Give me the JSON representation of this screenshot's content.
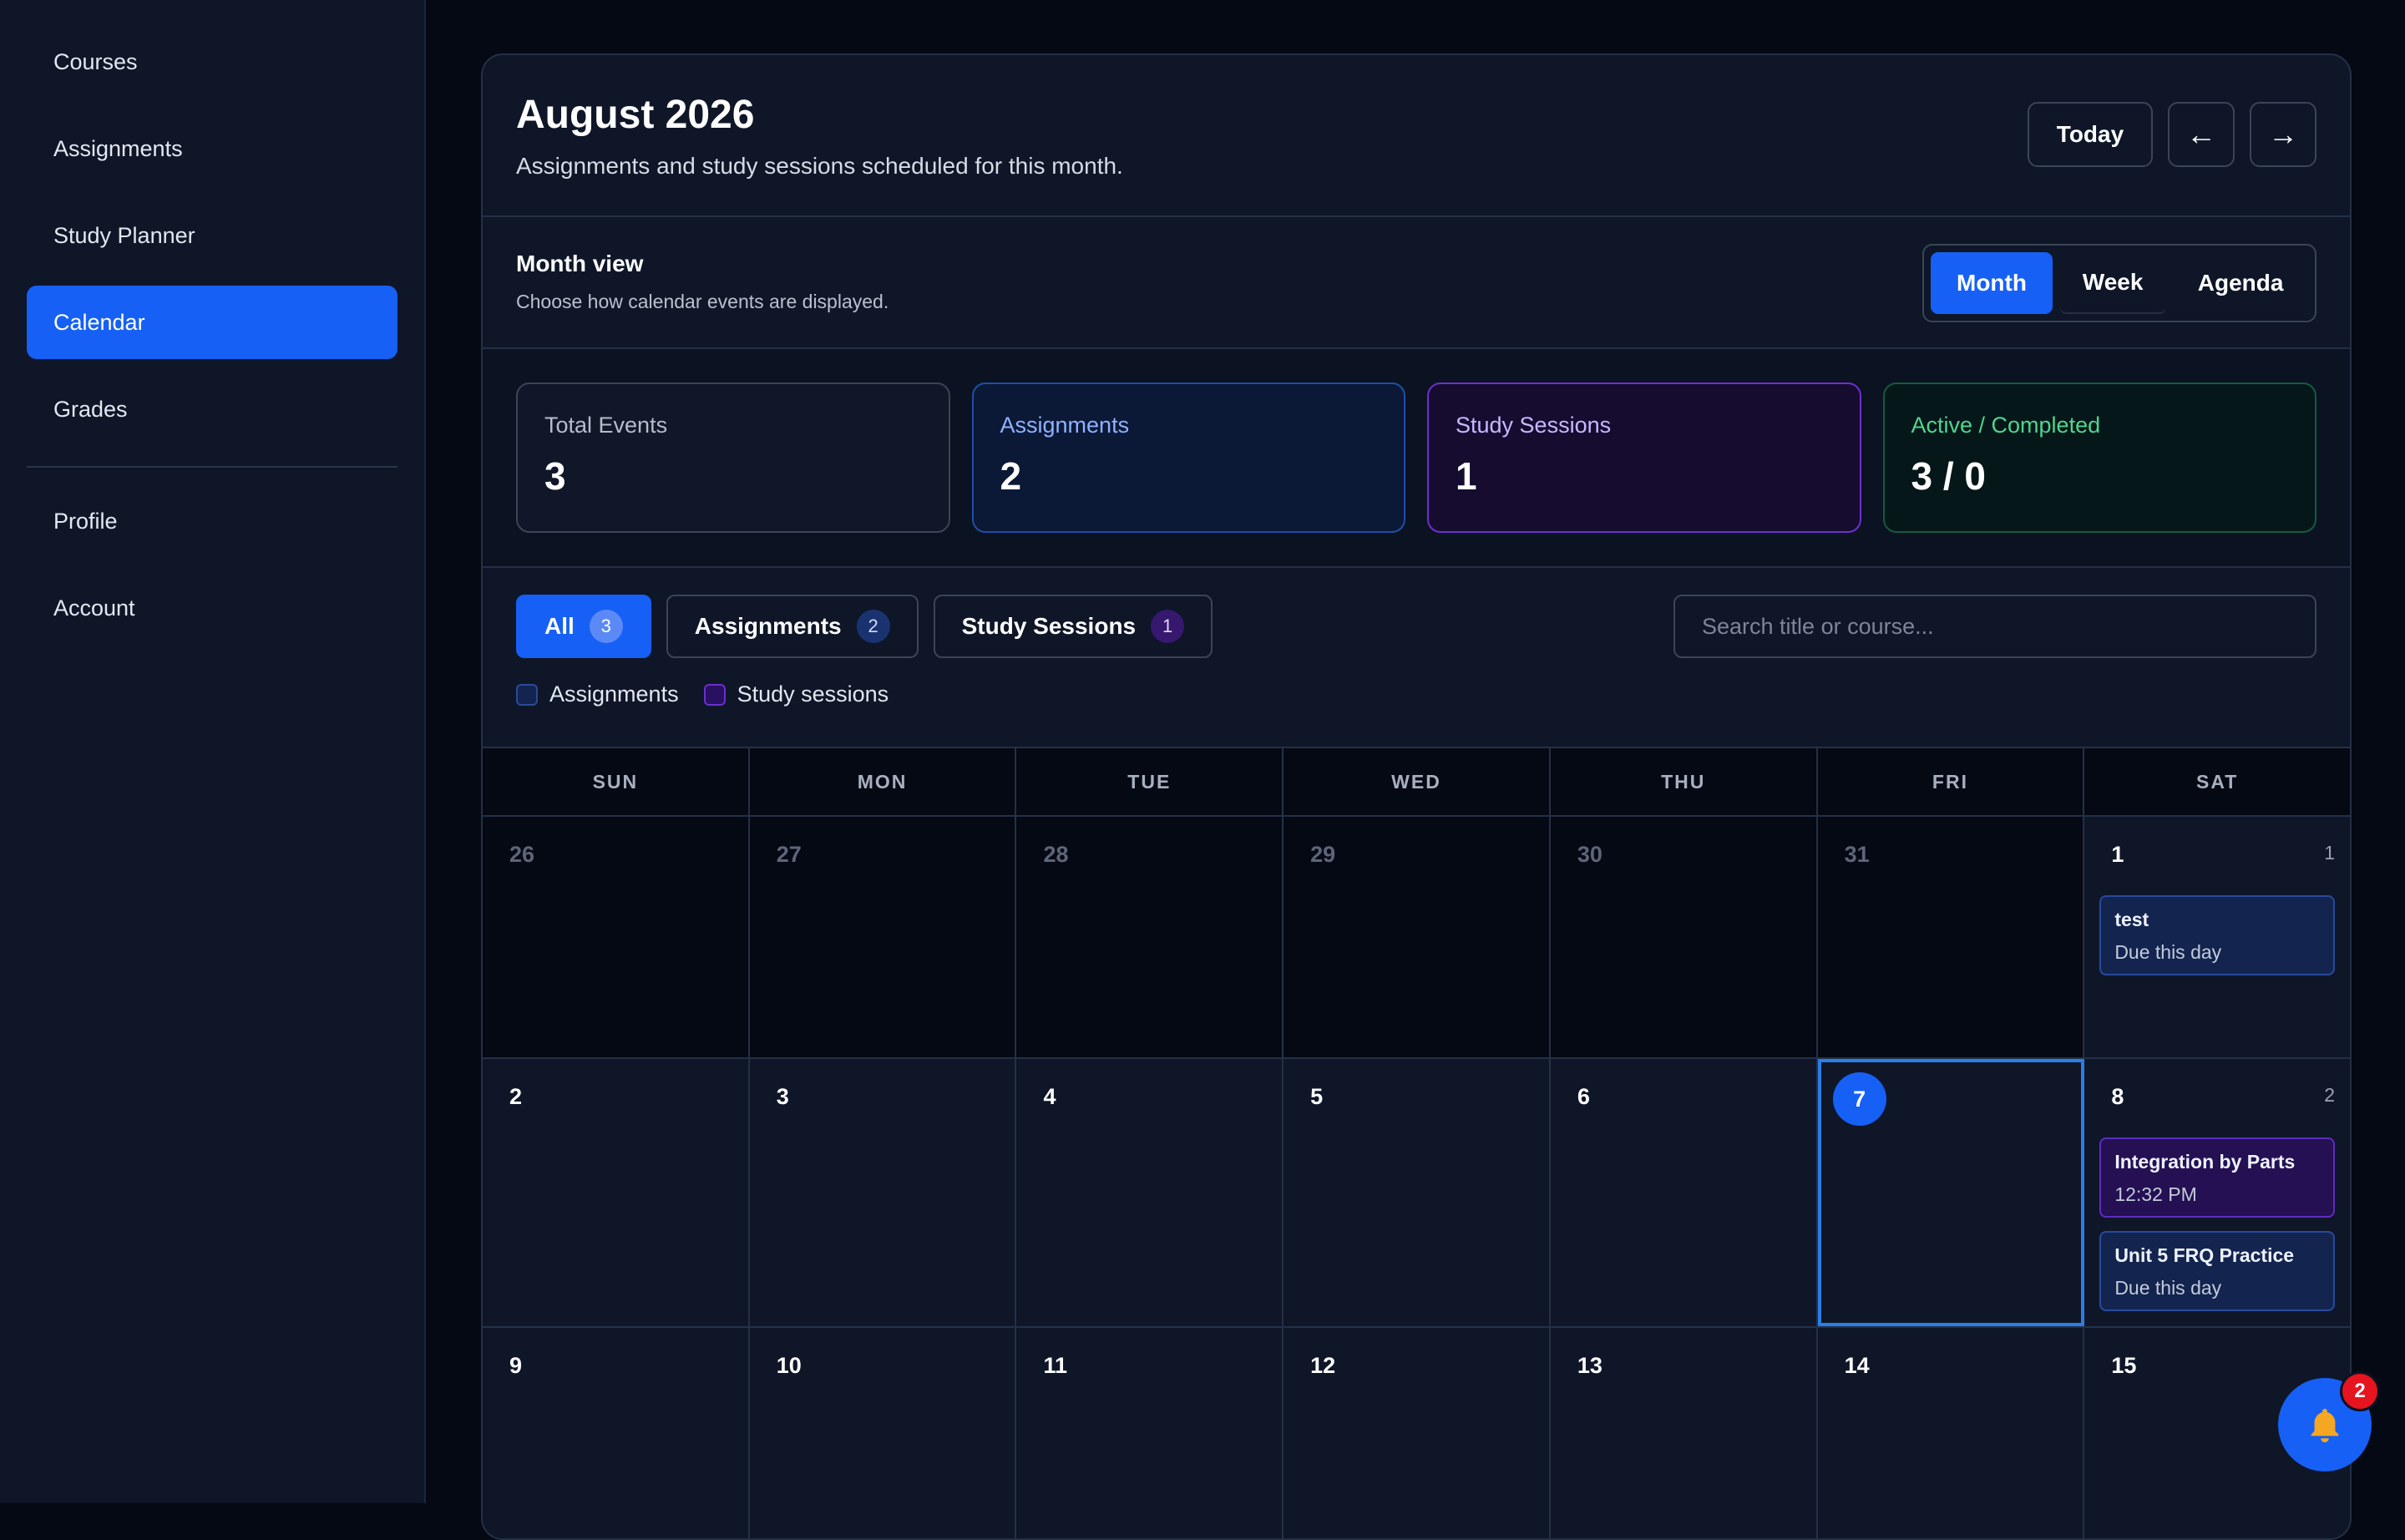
{
  "sidebar": {
    "items": [
      {
        "label": "Courses"
      },
      {
        "label": "Assignments"
      },
      {
        "label": "Study Planner"
      },
      {
        "label": "Calendar",
        "active": true
      },
      {
        "label": "Grades"
      }
    ],
    "secondary": [
      {
        "label": "Profile"
      },
      {
        "label": "Account"
      }
    ]
  },
  "header": {
    "title": "August 2026",
    "subtitle": "Assignments and study sessions scheduled for this month.",
    "today_label": "Today",
    "prev_label": "←",
    "next_label": "→"
  },
  "view": {
    "title": "Month view",
    "subtitle": "Choose how calendar events are displayed.",
    "options": [
      "Month",
      "Week",
      "Agenda"
    ],
    "selected": "Month"
  },
  "stats": [
    {
      "label": "Total Events",
      "value": "3"
    },
    {
      "label": "Assignments",
      "value": "2"
    },
    {
      "label": "Study Sessions",
      "value": "1"
    },
    {
      "label": "Active / Completed",
      "value": "3 / 0"
    }
  ],
  "filters": {
    "chips": [
      {
        "label": "All",
        "count": "3",
        "active": true
      },
      {
        "label": "Assignments",
        "count": "2"
      },
      {
        "label": "Study Sessions",
        "count": "1"
      }
    ],
    "search_placeholder": "Search title or course...",
    "legend": [
      "Assignments",
      "Study sessions"
    ]
  },
  "calendar": {
    "weekdays": [
      "SUN",
      "MON",
      "TUE",
      "WED",
      "THU",
      "FRI",
      "SAT"
    ],
    "weeks": [
      [
        {
          "day": "26",
          "out": true
        },
        {
          "day": "27",
          "out": true
        },
        {
          "day": "28",
          "out": true
        },
        {
          "day": "29",
          "out": true
        },
        {
          "day": "30",
          "out": true
        },
        {
          "day": "31",
          "out": true
        },
        {
          "day": "1",
          "count": "1",
          "events": [
            {
              "title": "test",
              "detail": "Due this day",
              "kind": "assignment"
            }
          ]
        }
      ],
      [
        {
          "day": "2"
        },
        {
          "day": "3"
        },
        {
          "day": "4"
        },
        {
          "day": "5"
        },
        {
          "day": "6"
        },
        {
          "day": "7",
          "today": true
        },
        {
          "day": "8",
          "count": "2",
          "events": [
            {
              "title": "Integration by Parts",
              "detail": "12:32 PM",
              "kind": "study"
            },
            {
              "title": "Unit 5 FRQ Practice",
              "detail": "Due this day",
              "kind": "assignment"
            }
          ]
        }
      ],
      [
        {
          "day": "9"
        },
        {
          "day": "10"
        },
        {
          "day": "11"
        },
        {
          "day": "12"
        },
        {
          "day": "13"
        },
        {
          "day": "14"
        },
        {
          "day": "15"
        }
      ]
    ]
  },
  "notifications": {
    "count": "2",
    "icon": "bell-icon"
  },
  "colors": {
    "accent": "#1660f5",
    "assignment": "#13244f",
    "study": "#241052",
    "badge": "#e5141e"
  }
}
